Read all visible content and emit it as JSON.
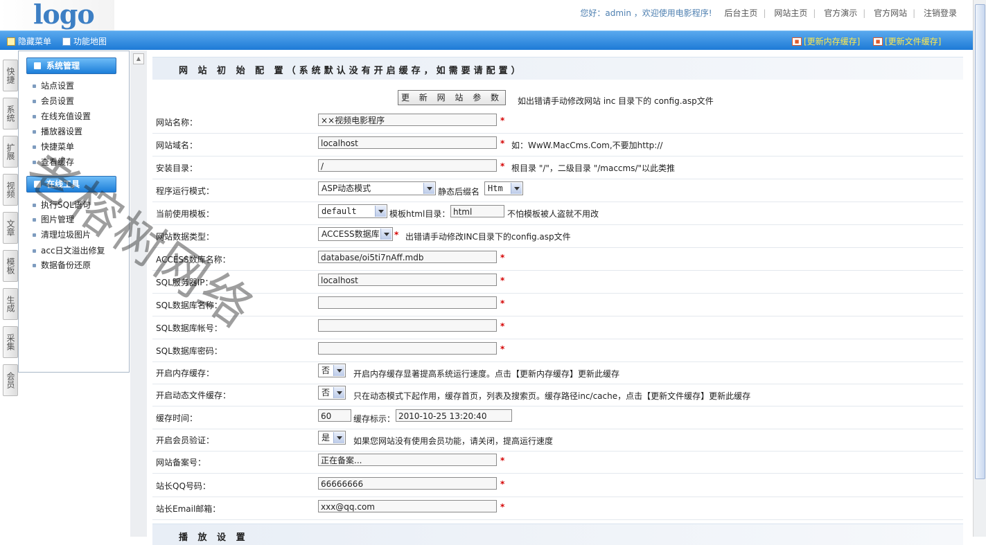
{
  "header": {
    "logo": "logo",
    "welcome": "您好：admin ，欢迎使用电影程序!",
    "links": [
      "后台主页",
      "网站主页",
      "官方演示",
      "官方网站",
      "注销登录"
    ]
  },
  "toolbar": {
    "hide_menu": "隐藏菜单",
    "func_map": "功能地图",
    "update_memory_cache": "[更新内存缓存]",
    "update_file_cache": "[更新文件缓存]"
  },
  "vtabs": [
    "快捷",
    "系统",
    "扩展",
    "视频",
    "文章",
    "模板",
    "生成",
    "采集",
    "会员"
  ],
  "sidebar": {
    "groups": [
      {
        "title": "系统管理",
        "items": [
          "站点设置",
          "会员设置",
          "在线充值设置",
          "播放器设置",
          "快捷菜单",
          "查看缓存"
        ]
      },
      {
        "title": "在线工具",
        "items": [
          "执行SQL语句",
          "图片管理",
          "清理垃圾图片",
          "acc日文溢出修复",
          "数据备份还原"
        ]
      }
    ]
  },
  "main": {
    "section_title": "网 站 初 始 配 置（系统默认没有开启缓存，如需要请配置）",
    "update_button": "更 新 网 站 参 数",
    "update_note": "如出错请手动修改网站 inc 目录下的 config.asp文件",
    "required_mark": "*",
    "fields": {
      "site_name": {
        "label": "网站名称：",
        "value": "××视频电影程序"
      },
      "site_domain": {
        "label": "网站域名：",
        "value": "localhost",
        "note": "如：WwW.MacCms.Com,不要加http://"
      },
      "install_dir": {
        "label": "安装目录：",
        "value": "/",
        "note": "根目录 \"/\"，二级目录 \"/maccms/\"以此类推"
      },
      "run_mode": {
        "label": "程序运行模式：",
        "value": "ASP动态模式",
        "suffix_label": "静态后缀名",
        "suffix_value": "Htm"
      },
      "template": {
        "label": "当前使用模板：",
        "value": "default",
        "dir_label": "模板html目录：",
        "dir_value": "html",
        "note": "不怕模板被人盗就不用改"
      },
      "db_type": {
        "label": "网站数据类型：",
        "value": "ACCESS数据库",
        "note": "出错请手动修改INC目录下的config.asp文件"
      },
      "access_name": {
        "label": "ACCESS数库名称：",
        "value": "database/oi5ti7nAff.mdb"
      },
      "sql_ip": {
        "label": "SQL服务器IP：",
        "value": "localhost"
      },
      "sql_db": {
        "label": "SQL数据库名称：",
        "value": ""
      },
      "sql_user": {
        "label": "SQL数据库帐号：",
        "value": ""
      },
      "sql_pass": {
        "label": "SQL数据库密码：",
        "value": ""
      },
      "mem_cache": {
        "label": "开启内存缓存：",
        "value": "否",
        "note": "开启内存缓存显著提高系统运行速度。点击【更新内存缓存】更新此缓存"
      },
      "file_cache": {
        "label": "开启动态文件缓存：",
        "value": "否",
        "note": "只在动态模式下起作用，缓存首页，列表及搜索页。缓存路径inc/cache，点击【更新文件缓存】更新此缓存"
      },
      "cache_time": {
        "label": "缓存时间：",
        "value": "60",
        "flag_label": "缓存标示：",
        "flag_value": "2010-10-25 13:20:40"
      },
      "member_verify": {
        "label": "开启会员验证：",
        "value": "是",
        "note": "如果您网站没有使用会员功能，请关闭，提高运行速度"
      },
      "icp": {
        "label": "网站备案号：",
        "value": "正在备案..."
      },
      "qq": {
        "label": "站长QQ号码：",
        "value": "66666666"
      },
      "email": {
        "label": "站长Email邮箱：",
        "value": "xxx@qq.com"
      }
    },
    "next_section": "播 放 设 置"
  },
  "watermark": "老榕树网络"
}
